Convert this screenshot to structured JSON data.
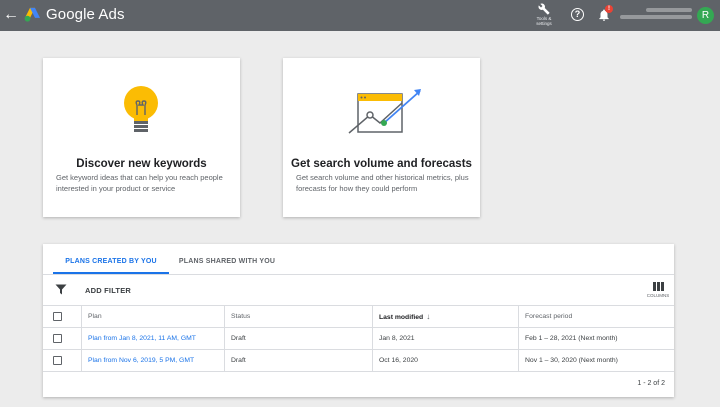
{
  "app": {
    "brand": "Google Ads",
    "avatar_letter": "R"
  },
  "header": {
    "tools_label": "Tools & settings",
    "bell_badge": "!",
    "icons": [
      "back-arrow-icon",
      "google-ads-logo",
      "wrench-icon",
      "help-icon",
      "bell-icon"
    ]
  },
  "cards": [
    {
      "title": "Discover new keywords",
      "description": "Get keyword ideas that can help you reach people interested in your product or service",
      "icon": "lightbulb-icon"
    },
    {
      "title": "Get search volume and forecasts",
      "description": "Get search volume and other historical metrics, plus forecasts for how they could perform",
      "icon": "forecast-chart-icon"
    }
  ],
  "plans": {
    "tabs": [
      {
        "label": "PLANS CREATED BY YOU",
        "active": true
      },
      {
        "label": "PLANS SHARED WITH YOU",
        "active": false
      }
    ],
    "add_filter": "ADD FILTER",
    "columns_label": "COLUMNS",
    "columns": [
      "Plan",
      "Status",
      "Last modified",
      "Forecast period"
    ],
    "rows": [
      {
        "plan": "Plan from Jan 8, 2021, 11 AM, GMT",
        "status": "Draft",
        "last_modified": "Jan 8, 2021",
        "forecast_period": "Feb 1 – 28, 2021 (Next month)"
      },
      {
        "plan": "Plan from Nov 6, 2019, 5 PM, GMT",
        "status": "Draft",
        "last_modified": "Oct 16, 2020",
        "forecast_period": "Nov 1 – 30, 2020 (Next month)"
      }
    ],
    "pagination": "1 - 2 of 2"
  },
  "colors": {
    "topbar": "#5f6368",
    "accent": "#1a73e8",
    "avatar": "#34a853",
    "bulb": "#fbbc04",
    "badge": "#ea4335"
  }
}
